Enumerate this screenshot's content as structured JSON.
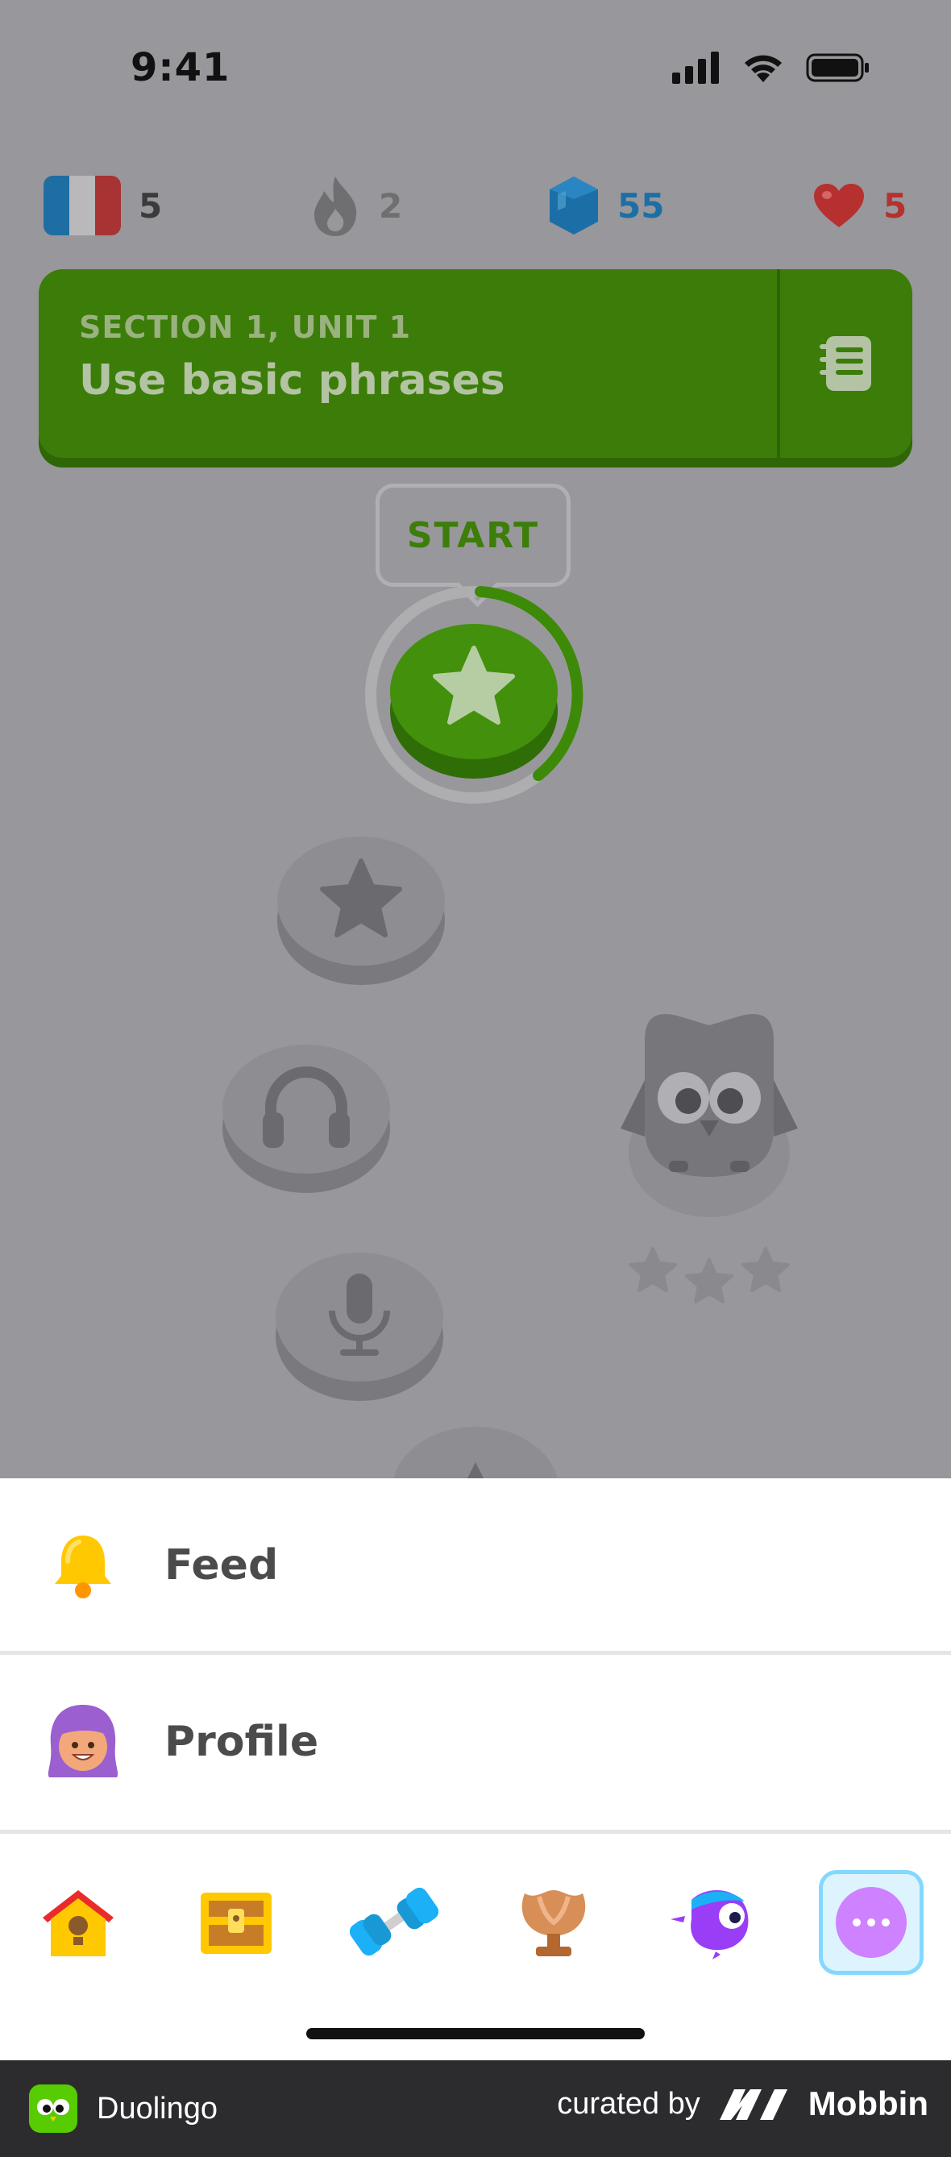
{
  "status_bar": {
    "time": "9:41"
  },
  "stats": {
    "language": {
      "value": "5",
      "color": "#3b3b3b"
    },
    "streak": {
      "value": "2",
      "color": "#6f6f72"
    },
    "gems": {
      "value": "55",
      "color": "#1c6fa6"
    },
    "hearts": {
      "value": "5",
      "color": "#b5302f"
    }
  },
  "unit": {
    "section": "SECTION 1, UNIT 1",
    "title": "Use basic phrases"
  },
  "path": {
    "start_label": "START",
    "nodes": [
      "star-lesson-active",
      "star-lesson",
      "listening-lesson",
      "speaking-lesson"
    ]
  },
  "menu": {
    "items": [
      {
        "label": "Feed",
        "icon": "bell-icon"
      },
      {
        "label": "Profile",
        "icon": "avatar-icon"
      }
    ]
  },
  "tabs": [
    "home-icon",
    "treasure-chest-icon",
    "dumbbell-icon",
    "trophy-icon",
    "character-icon",
    "more-icon"
  ],
  "footer": {
    "app_name": "Duolingo",
    "curated_by": "curated by",
    "brand": "Mobbin"
  },
  "colors": {
    "accent_green": "#58cc02",
    "dim_overlay": "#98979b",
    "active_tab_border": "#84d8ff"
  }
}
